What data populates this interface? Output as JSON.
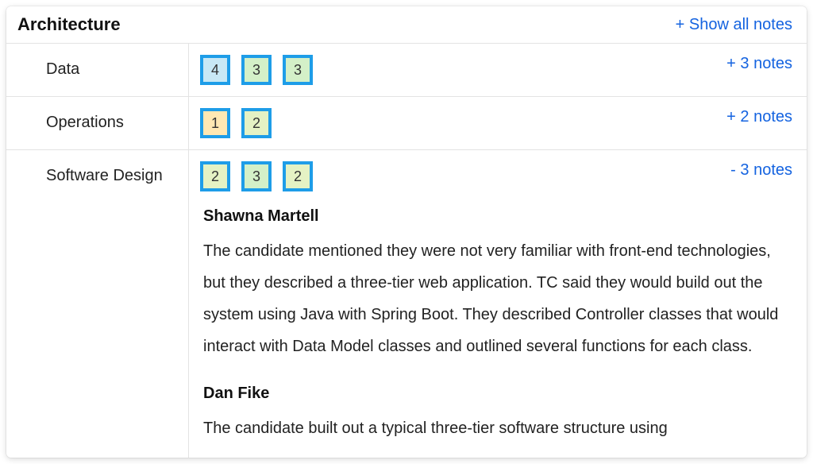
{
  "header": {
    "title": "Architecture",
    "show_all": "+ Show all notes"
  },
  "rows": [
    {
      "label": "Data",
      "scores": [
        4,
        3,
        3
      ],
      "notes_link": "+ 3 notes",
      "expanded": false
    },
    {
      "label": "Operations",
      "scores": [
        1,
        2
      ],
      "notes_link": "+ 2 notes",
      "expanded": false
    },
    {
      "label": "Software Design",
      "scores": [
        2,
        3,
        2
      ],
      "notes_link": "- 3 notes",
      "expanded": true,
      "notes": [
        {
          "author": "Shawna Martell",
          "text": "The candidate mentioned they were not very familiar with front-end technologies, but they described a three-tier web application. TC said they would build out the system using Java with Spring Boot. They described Controller classes that would interact with Data Model classes and outlined several functions for each class."
        },
        {
          "author": "Dan Fike",
          "text": "The candidate built out a typical three-tier software structure using"
        }
      ]
    }
  ]
}
